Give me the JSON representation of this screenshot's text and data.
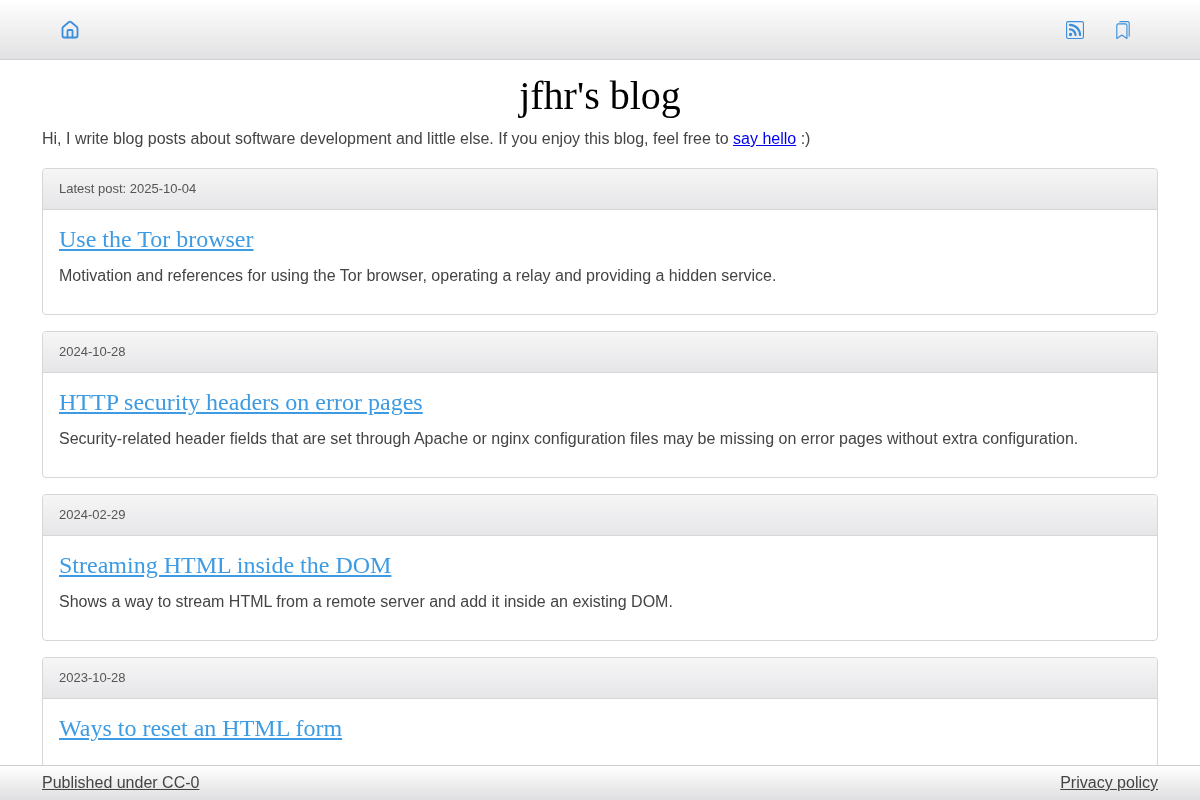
{
  "blog": {
    "title": "jfhr's blog",
    "intro": {
      "before": "Hi, I write blog posts about software development and little else. If you enjoy this blog, feel free to",
      "link": "say hello",
      "after": ":)"
    }
  },
  "posts": [
    {
      "date_label": "Latest post: 2025-10-04",
      "title": "Use the Tor browser",
      "summary": "Motivation and references for using the Tor browser, operating a relay and providing a hidden service."
    },
    {
      "date_label": "2024-10-28",
      "title": "HTTP security headers on error pages",
      "summary": "Security-related header fields that are set through Apache or nginx configuration files may be missing on error pages without extra configuration."
    },
    {
      "date_label": "2024-02-29",
      "title": "Streaming HTML inside the DOM",
      "summary": "Shows a way to stream HTML from a remote server and add it inside an existing DOM."
    },
    {
      "date_label": "2023-10-28",
      "title": "Ways to reset an HTML form"
    }
  ],
  "footer": {
    "links": [
      "Published under CC-0",
      "Privacy policy"
    ]
  }
}
